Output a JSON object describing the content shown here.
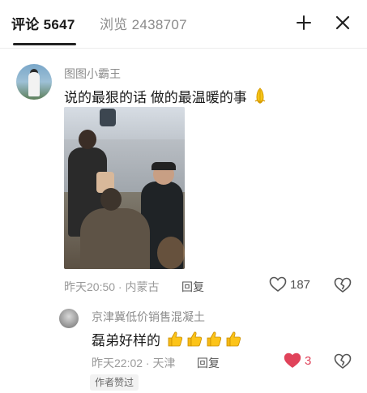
{
  "header": {
    "tabs": [
      {
        "label": "评论 5647",
        "active": true
      },
      {
        "label": "浏览 2438707",
        "active": false
      }
    ],
    "icons": [
      "shrink-icon",
      "close-icon"
    ]
  },
  "comment": {
    "username": "图图小霸王",
    "text": "说的最狠的话 做的最温暖的事",
    "emoji": "pray-hands-icon",
    "time_location": "昨天20:50 · 内蒙古",
    "reply_label": "回复",
    "like_count": "187"
  },
  "reply": {
    "username": "京津冀低价销售混凝土",
    "text": "磊弟好样的",
    "emoji": "thumbs-up-icon",
    "emoji_count": 4,
    "time_location": "昨天22:02 · 天津",
    "reply_label": "回复",
    "like_count": "3",
    "liked": true,
    "badge": "作者赞过"
  },
  "colors": {
    "accent_like": "#e0435a",
    "text_primary": "#1a1a1a",
    "text_meta": "#9a9a9a"
  }
}
